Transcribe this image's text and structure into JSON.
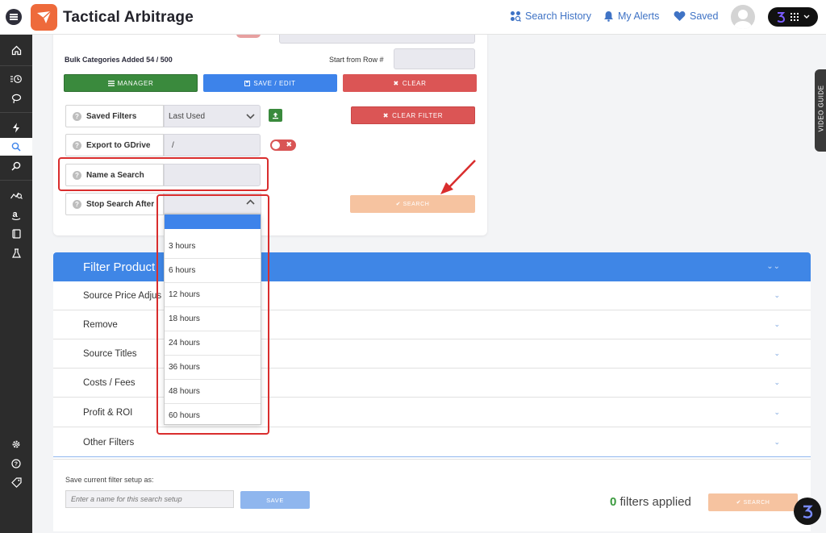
{
  "header": {
    "title": "Tactical Arbitrage",
    "nav": [
      {
        "label": "Search History",
        "icon": "search-history-icon"
      },
      {
        "label": "My Alerts",
        "icon": "bell-icon"
      },
      {
        "label": "Saved",
        "icon": "heart-icon"
      }
    ],
    "app_switch_icon": "grid-icon"
  },
  "colors": {
    "brand": "#ee6a3b",
    "primary": "#3d83ea",
    "danger": "#db5555",
    "success": "#3a8a3d",
    "highlight": "#d92d2d"
  },
  "bulk": {
    "label": "Bulk Categories Added 54 / 500",
    "start_row_label": "Start from Row #",
    "manager_label": "MANAGER",
    "save_edit_label": "SAVE / EDIT",
    "clear_label": "CLEAR"
  },
  "form": {
    "saved_filters_label": "Saved Filters",
    "saved_filters_value": "Last Used",
    "clear_filter_label": "CLEAR FILTER",
    "export_label": "Export to GDrive",
    "export_value": "/",
    "name_search_label": "Name a Search",
    "stop_search_label": "Stop Search After",
    "search_label": "SEARCH"
  },
  "dropdown": {
    "options": [
      "3 hours",
      "6 hours",
      "12 hours",
      "18 hours",
      "24 hours",
      "36 hours",
      "48 hours",
      "60 hours"
    ]
  },
  "filters": {
    "header": "Filter Product",
    "rows": [
      "Source Price Adjus",
      "Remove",
      "Source Titles",
      "Costs / Fees",
      "Profit & ROI",
      "Other Filters"
    ]
  },
  "footer": {
    "save_setup_label": "Save current filter setup as:",
    "save_input_placeholder": "Enter a name for this search setup",
    "save_label": "SAVE",
    "filters_count": "0",
    "filters_applied_label": "filters applied",
    "search_label": "SEARCH"
  },
  "video_guide": "VIDEO GUIDE"
}
